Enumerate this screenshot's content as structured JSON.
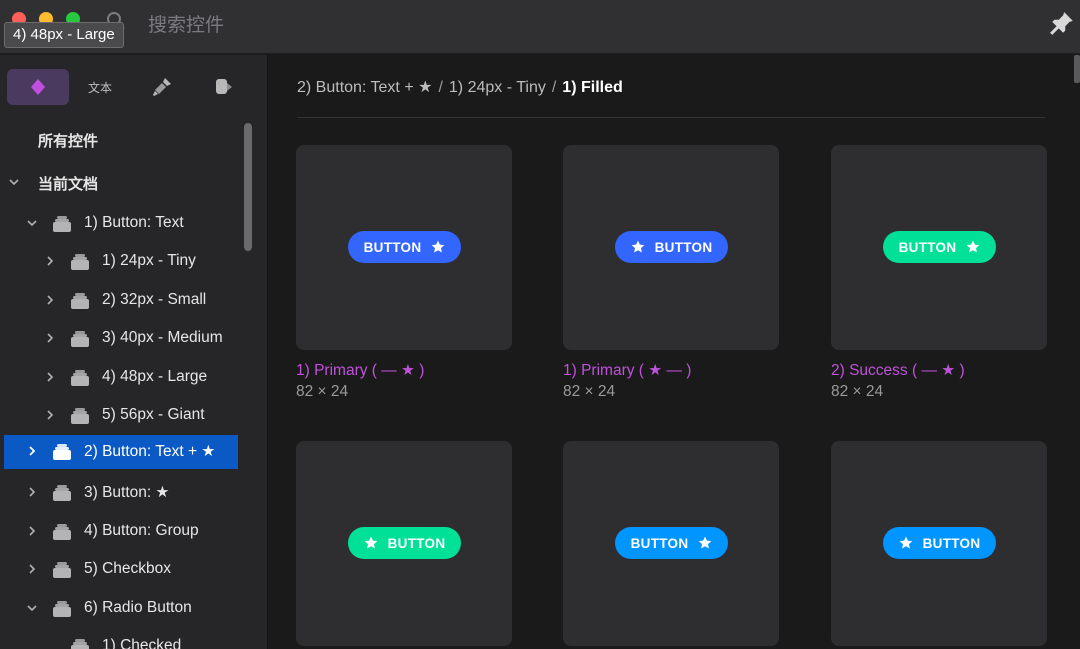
{
  "window": {
    "search_placeholder": "搜索控件",
    "tooltip": "4) 48px - Large"
  },
  "sidebar": {
    "tabs": [
      {
        "name": "symbols",
        "icon": "diamond-icon",
        "active": true
      },
      {
        "name": "text",
        "label": "文本",
        "active": false
      },
      {
        "name": "styles",
        "icon": "brush-icon",
        "active": false
      },
      {
        "name": "colors",
        "icon": "paint-bucket-icon",
        "active": false
      }
    ],
    "all_label": "所有控件",
    "doc_label": "当前文档",
    "tree": [
      {
        "label": "1) Button: Text",
        "expanded": true
      },
      {
        "label": "1) 24px - Tiny",
        "expanded": false
      },
      {
        "label": "2) 32px - Small",
        "expanded": false
      },
      {
        "label": "3) 40px - Medium",
        "expanded": false
      },
      {
        "label": "4) 48px - Large",
        "expanded": false
      },
      {
        "label": "5) 56px - Giant",
        "expanded": false
      },
      {
        "label": "2) Button: Text + ★",
        "expanded": false,
        "selected": true
      },
      {
        "label": "3) Button: ★",
        "expanded": false
      },
      {
        "label": "4) Button: Group",
        "expanded": false
      },
      {
        "label": "5) Checkbox",
        "expanded": false
      },
      {
        "label": "6) Radio Button",
        "expanded": true
      },
      {
        "label": "1) Checked",
        "expanded": false
      }
    ]
  },
  "breadcrumb": {
    "items": [
      "2) Button: Text + ★",
      "1) 24px - Tiny"
    ],
    "current": "1) Filled",
    "separator": "/"
  },
  "cards": [
    {
      "button_label": "BUTTON",
      "star_position": "right",
      "color": "#3366ff",
      "title": "1) Primary ( — ★ )",
      "size": "82 × 24"
    },
    {
      "button_label": "BUTTON",
      "star_position": "left",
      "color": "#3366ff",
      "title": "1) Primary ( ★ — )",
      "size": "82 × 24"
    },
    {
      "button_label": "BUTTON",
      "star_position": "right",
      "color": "#00e096",
      "title": "2) Success ( — ★ )",
      "size": "82 × 24"
    },
    {
      "button_label": "BUTTON",
      "star_position": "left",
      "color": "#00e096"
    },
    {
      "button_label": "BUTTON",
      "star_position": "right",
      "color": "#0095ff"
    },
    {
      "button_label": "BUTTON",
      "star_position": "left",
      "color": "#0095ff"
    }
  ],
  "colors": {
    "accent_selected": "#0a59c4",
    "label_purple": "#c052d9"
  }
}
